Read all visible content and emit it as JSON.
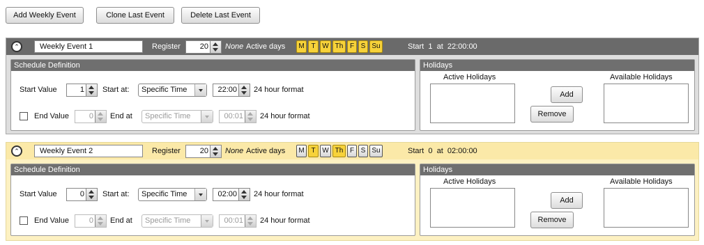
{
  "toolbar": {
    "add_label": "Add Weekly Event",
    "clone_label": "Clone Last Event",
    "delete_label": "Delete Last Event"
  },
  "labels": {
    "register": "Register",
    "none": "None",
    "active_days": "Active days",
    "schedule_definition": "Schedule Definition",
    "start_value": "Start Value",
    "start_at": "Start at:",
    "end_value": "End Value",
    "end_at": "End at",
    "format": "24 hour format",
    "holidays": "Holidays",
    "active_holidays": "Active Holidays",
    "available_holidays": "Available Holidays",
    "add": "Add",
    "remove": "Remove"
  },
  "days": [
    "M",
    "T",
    "W",
    "Th",
    "F",
    "S",
    "Su"
  ],
  "events": [
    {
      "name": "Weekly Event 1",
      "register": "20",
      "active_days": [
        true,
        true,
        true,
        true,
        true,
        true,
        true
      ],
      "summary": "Start  1  at  22:00:00",
      "start_value": "1",
      "start_at": "Specific Time",
      "start_time": "22:00",
      "end_enabled": false,
      "end_value": "0",
      "end_at": "Specific Time",
      "end_time": "00:01"
    },
    {
      "name": "Weekly Event 2",
      "register": "20",
      "active_days": [
        false,
        true,
        false,
        true,
        false,
        false,
        false
      ],
      "summary": "Start  0  at  02:00:00",
      "start_value": "0",
      "start_at": "Specific Time",
      "start_time": "02:00",
      "end_enabled": false,
      "end_value": "0",
      "end_at": "Specific Time",
      "end_time": "00:01"
    }
  ],
  "colors": {
    "active_day": "#f7d23a",
    "event1_header": "#6a6a6a",
    "event2_header": "#fbe9a8",
    "panel_title": "#6f6f6f"
  }
}
